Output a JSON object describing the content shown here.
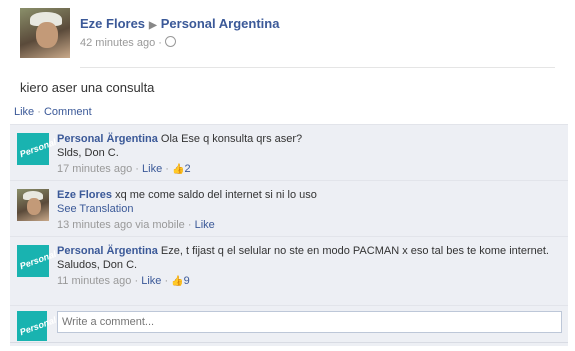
{
  "post": {
    "author": "Eze Flores",
    "arrow": "▶",
    "target": "Personal Argentina",
    "time": "42 minutes ago",
    "sep": "·",
    "text": "kiero aser una consulta"
  },
  "actions": {
    "like": "Like",
    "sep": "·",
    "comment": "Comment"
  },
  "comments": [
    {
      "author": "Personal Ärgentina",
      "text": "Ola Ese q konsulta qrs aser?",
      "text2": "Slds, Don C.",
      "time": "17 minutes ago",
      "sep": "·",
      "like": "Like",
      "likes": "2"
    },
    {
      "author": "Eze Flores",
      "text": "xq me come saldo del internet si ni lo uso",
      "translate": "See Translation",
      "time": "13 minutes ago via mobile",
      "sep": "·",
      "like": "Like"
    },
    {
      "author": "Personal Ärgentina",
      "text": "Eze, t fijast q el selular no ste en modo PACMAN x eso tal bes te kome internet.",
      "text2": "Saludos, Don C.",
      "time": "11 minutes ago",
      "sep": "·",
      "like": "Like",
      "likes": "9"
    }
  ],
  "avatar_text": "Personal",
  "write": {
    "placeholder": "Write a comment..."
  },
  "colors": {
    "link": "#3b5998",
    "comment_bg": "#edeff4",
    "brand": "#19b3b0"
  }
}
